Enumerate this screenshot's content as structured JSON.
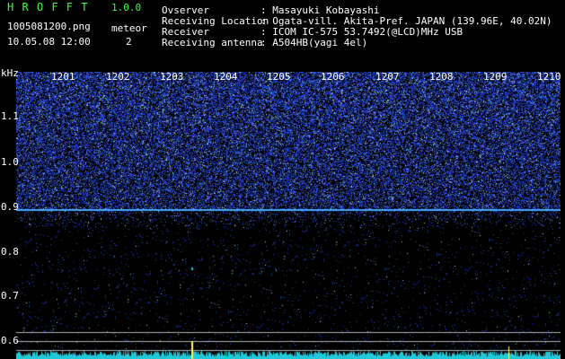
{
  "header": {
    "app_title": "H R O F F T",
    "version": "1.0.0",
    "filename": "1005081200.png",
    "meteor_label": "meteor",
    "datetime": "10.05.08 12:00",
    "meteor_count": "2",
    "info": [
      {
        "label": "Ovserver",
        "value": ": Masayuki Kobayashi"
      },
      {
        "label": "Receiving Location",
        "value": ": Ogata-vill. Akita-Pref. JAPAN (139.96E, 40.02N)"
      },
      {
        "label": "Receiver",
        "value": ": ICOM IC-575 53.7492(@LCD)MHz USB"
      },
      {
        "label": "Receiving antenna",
        "value": ": A504HB(yagi 4el)"
      }
    ]
  },
  "axis": {
    "y_unit": "kHz",
    "y_ticks": [
      "1.1",
      "1.0",
      "0.9",
      "0.8",
      "0.7",
      "0.6"
    ],
    "x_ticks": [
      "1201",
      "1202",
      "1203",
      "1204",
      "1205",
      "1206",
      "1207",
      "1208",
      "1209",
      "1210"
    ]
  },
  "colors": {
    "background": "#000000",
    "noise": "#2a3cff",
    "carrier_line": "#4aa8ff",
    "spectrum": "#20c8d8",
    "meteor": "#ffff40",
    "frame": "#b0b0b0",
    "header_green": "#33ff33"
  }
}
